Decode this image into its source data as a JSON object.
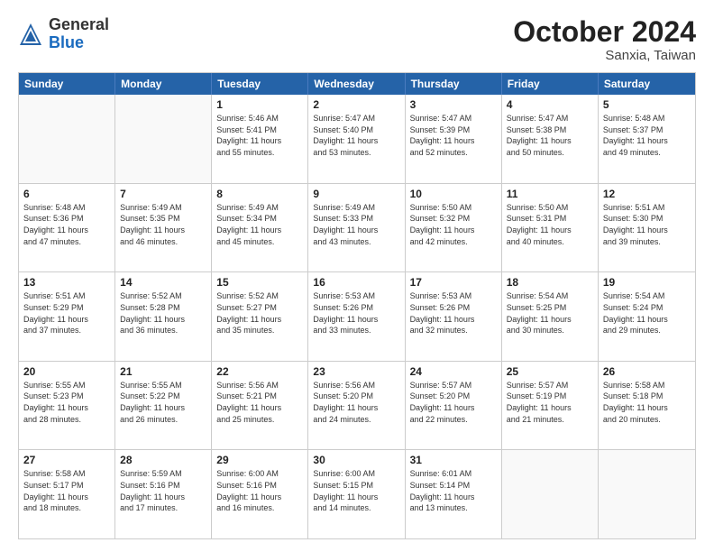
{
  "header": {
    "logo": {
      "general": "General",
      "blue": "Blue"
    },
    "month": "October 2024",
    "location": "Sanxia, Taiwan"
  },
  "days_of_week": [
    "Sunday",
    "Monday",
    "Tuesday",
    "Wednesday",
    "Thursday",
    "Friday",
    "Saturday"
  ],
  "weeks": [
    [
      {
        "day": "",
        "info": ""
      },
      {
        "day": "",
        "info": ""
      },
      {
        "day": "1",
        "info": "Sunrise: 5:46 AM\nSunset: 5:41 PM\nDaylight: 11 hours\nand 55 minutes."
      },
      {
        "day": "2",
        "info": "Sunrise: 5:47 AM\nSunset: 5:40 PM\nDaylight: 11 hours\nand 53 minutes."
      },
      {
        "day": "3",
        "info": "Sunrise: 5:47 AM\nSunset: 5:39 PM\nDaylight: 11 hours\nand 52 minutes."
      },
      {
        "day": "4",
        "info": "Sunrise: 5:47 AM\nSunset: 5:38 PM\nDaylight: 11 hours\nand 50 minutes."
      },
      {
        "day": "5",
        "info": "Sunrise: 5:48 AM\nSunset: 5:37 PM\nDaylight: 11 hours\nand 49 minutes."
      }
    ],
    [
      {
        "day": "6",
        "info": "Sunrise: 5:48 AM\nSunset: 5:36 PM\nDaylight: 11 hours\nand 47 minutes."
      },
      {
        "day": "7",
        "info": "Sunrise: 5:49 AM\nSunset: 5:35 PM\nDaylight: 11 hours\nand 46 minutes."
      },
      {
        "day": "8",
        "info": "Sunrise: 5:49 AM\nSunset: 5:34 PM\nDaylight: 11 hours\nand 45 minutes."
      },
      {
        "day": "9",
        "info": "Sunrise: 5:49 AM\nSunset: 5:33 PM\nDaylight: 11 hours\nand 43 minutes."
      },
      {
        "day": "10",
        "info": "Sunrise: 5:50 AM\nSunset: 5:32 PM\nDaylight: 11 hours\nand 42 minutes."
      },
      {
        "day": "11",
        "info": "Sunrise: 5:50 AM\nSunset: 5:31 PM\nDaylight: 11 hours\nand 40 minutes."
      },
      {
        "day": "12",
        "info": "Sunrise: 5:51 AM\nSunset: 5:30 PM\nDaylight: 11 hours\nand 39 minutes."
      }
    ],
    [
      {
        "day": "13",
        "info": "Sunrise: 5:51 AM\nSunset: 5:29 PM\nDaylight: 11 hours\nand 37 minutes."
      },
      {
        "day": "14",
        "info": "Sunrise: 5:52 AM\nSunset: 5:28 PM\nDaylight: 11 hours\nand 36 minutes."
      },
      {
        "day": "15",
        "info": "Sunrise: 5:52 AM\nSunset: 5:27 PM\nDaylight: 11 hours\nand 35 minutes."
      },
      {
        "day": "16",
        "info": "Sunrise: 5:53 AM\nSunset: 5:26 PM\nDaylight: 11 hours\nand 33 minutes."
      },
      {
        "day": "17",
        "info": "Sunrise: 5:53 AM\nSunset: 5:26 PM\nDaylight: 11 hours\nand 32 minutes."
      },
      {
        "day": "18",
        "info": "Sunrise: 5:54 AM\nSunset: 5:25 PM\nDaylight: 11 hours\nand 30 minutes."
      },
      {
        "day": "19",
        "info": "Sunrise: 5:54 AM\nSunset: 5:24 PM\nDaylight: 11 hours\nand 29 minutes."
      }
    ],
    [
      {
        "day": "20",
        "info": "Sunrise: 5:55 AM\nSunset: 5:23 PM\nDaylight: 11 hours\nand 28 minutes."
      },
      {
        "day": "21",
        "info": "Sunrise: 5:55 AM\nSunset: 5:22 PM\nDaylight: 11 hours\nand 26 minutes."
      },
      {
        "day": "22",
        "info": "Sunrise: 5:56 AM\nSunset: 5:21 PM\nDaylight: 11 hours\nand 25 minutes."
      },
      {
        "day": "23",
        "info": "Sunrise: 5:56 AM\nSunset: 5:20 PM\nDaylight: 11 hours\nand 24 minutes."
      },
      {
        "day": "24",
        "info": "Sunrise: 5:57 AM\nSunset: 5:20 PM\nDaylight: 11 hours\nand 22 minutes."
      },
      {
        "day": "25",
        "info": "Sunrise: 5:57 AM\nSunset: 5:19 PM\nDaylight: 11 hours\nand 21 minutes."
      },
      {
        "day": "26",
        "info": "Sunrise: 5:58 AM\nSunset: 5:18 PM\nDaylight: 11 hours\nand 20 minutes."
      }
    ],
    [
      {
        "day": "27",
        "info": "Sunrise: 5:58 AM\nSunset: 5:17 PM\nDaylight: 11 hours\nand 18 minutes."
      },
      {
        "day": "28",
        "info": "Sunrise: 5:59 AM\nSunset: 5:16 PM\nDaylight: 11 hours\nand 17 minutes."
      },
      {
        "day": "29",
        "info": "Sunrise: 6:00 AM\nSunset: 5:16 PM\nDaylight: 11 hours\nand 16 minutes."
      },
      {
        "day": "30",
        "info": "Sunrise: 6:00 AM\nSunset: 5:15 PM\nDaylight: 11 hours\nand 14 minutes."
      },
      {
        "day": "31",
        "info": "Sunrise: 6:01 AM\nSunset: 5:14 PM\nDaylight: 11 hours\nand 13 minutes."
      },
      {
        "day": "",
        "info": ""
      },
      {
        "day": "",
        "info": ""
      }
    ]
  ]
}
